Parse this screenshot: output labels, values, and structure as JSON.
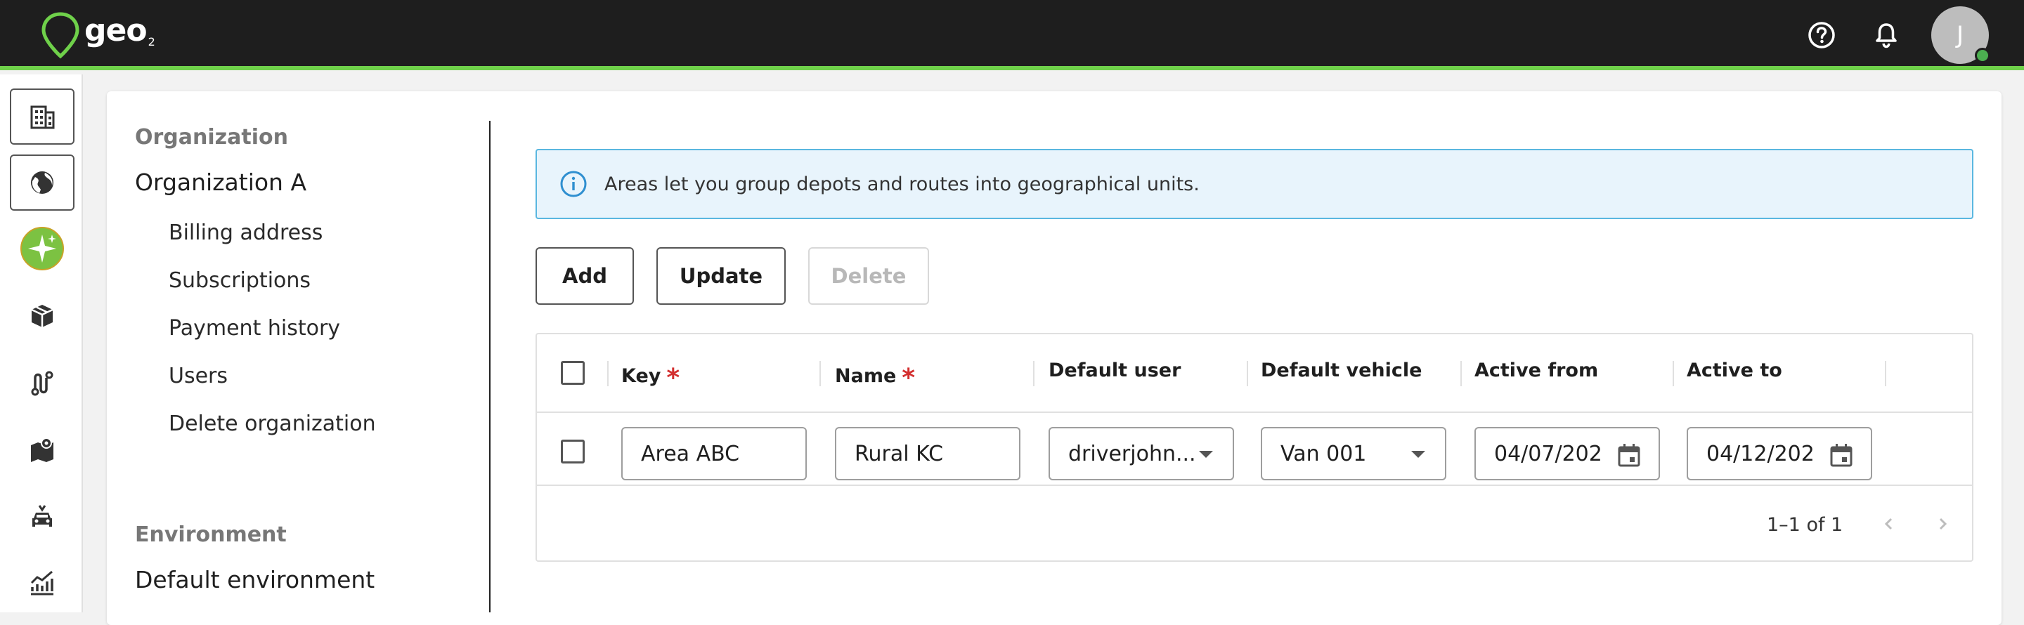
{
  "app": {
    "logo_text": "geo",
    "logo_sub": "2"
  },
  "topbar": {
    "help_icon": "help-circle-icon",
    "notifications_icon": "bell-icon",
    "avatar_initial": "J",
    "accent_color": "#6fd14a",
    "status_color": "#4caf50"
  },
  "rail": {
    "items": [
      {
        "name": "organization",
        "icon": "building-icon"
      },
      {
        "name": "environment",
        "icon": "globe-icon"
      },
      {
        "name": "assistant",
        "icon": "sparkle-icon"
      },
      {
        "name": "packages",
        "icon": "box-icon"
      },
      {
        "name": "routes",
        "icon": "route-icon"
      },
      {
        "name": "areas",
        "icon": "map-icon"
      },
      {
        "name": "vehicles",
        "icon": "car-icon"
      },
      {
        "name": "analytics",
        "icon": "chart-icon"
      }
    ]
  },
  "leftnav": {
    "organization_heading": "Organization",
    "organization_name": "Organization A",
    "items": [
      "Billing address",
      "Subscriptions",
      "Payment history",
      "Users",
      "Delete organization"
    ],
    "environment_heading": "Environment",
    "environment_name": "Default environment"
  },
  "banner": {
    "text": "Areas let you group depots and routes into geographical units.",
    "icon": "info-icon"
  },
  "actions": {
    "add": "Add",
    "update": "Update",
    "delete": "Delete"
  },
  "table": {
    "columns": {
      "key": "Key",
      "name": "Name",
      "default_user": "Default user",
      "default_vehicle": "Default vehicle",
      "active_from": "Active from",
      "active_to": "Active to"
    },
    "required_mark": "*",
    "rows": [
      {
        "key": "Area ABC",
        "name": "Rural KC",
        "default_user": "driverjohn...",
        "default_vehicle": "Van 001",
        "active_from": "04/07/202",
        "active_to": "04/12/202"
      }
    ],
    "pagination": "1–1 of 1"
  }
}
